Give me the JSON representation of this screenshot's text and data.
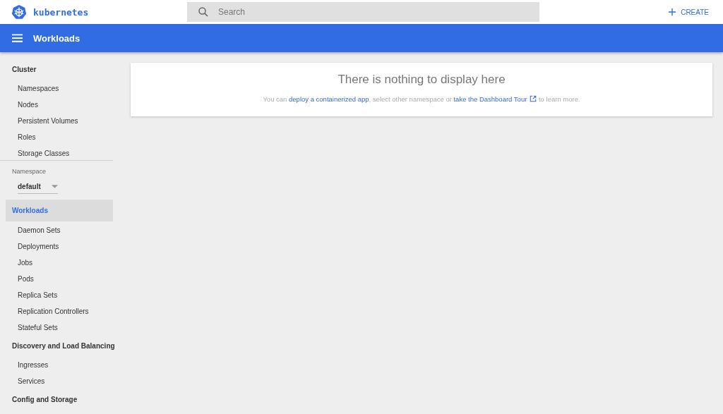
{
  "header": {
    "logo_text": "kubernetes",
    "search": {
      "placeholder": "Search"
    },
    "create_label": "CREATE"
  },
  "toolbar": {
    "title": "Workloads"
  },
  "sidebar": {
    "sections": [
      {
        "kind": "group",
        "title": "Cluster",
        "selected": false,
        "items": [
          "Namespaces",
          "Nodes",
          "Persistent Volumes",
          "Roles",
          "Storage Classes"
        ]
      },
      {
        "kind": "namespace",
        "label": "Namespace",
        "value": "default"
      },
      {
        "kind": "group",
        "title": "Workloads",
        "selected": true,
        "items": [
          "Daemon Sets",
          "Deployments",
          "Jobs",
          "Pods",
          "Replica Sets",
          "Replication Controllers",
          "Stateful Sets"
        ]
      },
      {
        "kind": "group",
        "title": "Discovery and Load Balancing",
        "selected": false,
        "items": [
          "Ingresses",
          "Services"
        ]
      },
      {
        "kind": "group",
        "title": "Config and Storage",
        "selected": false
      }
    ]
  },
  "empty_state": {
    "title": "There is nothing to display here",
    "message": {
      "before": "You can ",
      "deploy_link": "deploy a containerized app",
      "middle": ", select other namespace or ",
      "tour_link": "take the Dashboard Tour",
      "after": " to learn more."
    }
  }
}
